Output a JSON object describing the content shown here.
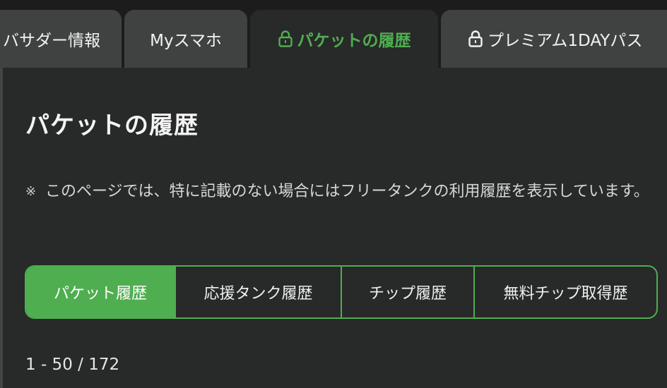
{
  "tabs": [
    {
      "label": "バサダー情報",
      "locked": false,
      "active": false
    },
    {
      "label": "Myスマホ",
      "locked": false,
      "active": false
    },
    {
      "label": "パケットの履歴",
      "locked": true,
      "active": true
    },
    {
      "label": "プレミアム1DAYパス",
      "locked": true,
      "active": false
    }
  ],
  "page": {
    "title": "パケットの履歴",
    "note_mark": "※",
    "note_text": "このページでは、特に記載のない場合にはフリータンクの利用履歴を表示しています。"
  },
  "segments": [
    {
      "label": "パケット履歴",
      "active": true
    },
    {
      "label": "応援タンク履歴",
      "active": false
    },
    {
      "label": "チップ履歴",
      "active": false
    },
    {
      "label": "無料チップ取得歴",
      "active": false
    }
  ],
  "pagination": {
    "range": "1 - 50 / 172"
  },
  "colors": {
    "accent": "#4fae50",
    "background": "#282929",
    "tab_inactive": "#404241"
  },
  "icons": {
    "lock": "lock-icon"
  }
}
